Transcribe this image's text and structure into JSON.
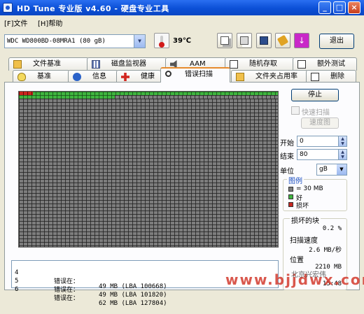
{
  "window": {
    "title": "HD Tune 专业版 v4.60 - 硬盘专业工具"
  },
  "titlebar_buttons": {
    "minimize": "_",
    "maximize": "□",
    "close": "×"
  },
  "menu": {
    "file": "[F]文件",
    "help": "[H]帮助"
  },
  "toolbar": {
    "drive": "WDC WD800BD-08MRA1 (80 gB)",
    "temperature": "39℃",
    "exit_label": "退出",
    "download_glyph": "↓"
  },
  "tabs_top": [
    {
      "label": "文件基准"
    },
    {
      "label": "磁盘监视器"
    },
    {
      "label": "AAM"
    },
    {
      "label": "随机存取"
    },
    {
      "label": "额外测试"
    }
  ],
  "tabs_bottom": [
    {
      "label": "基准"
    },
    {
      "label": "信息"
    },
    {
      "label": "健康"
    },
    {
      "label": "错误扫描"
    },
    {
      "label": "文件夹占用率"
    },
    {
      "label": "删除"
    }
  ],
  "controls": {
    "stop_label": "停止",
    "quick_scan_label": "快速扫描",
    "speed_map_label": "速度图",
    "start_label": "开始",
    "start_value": "0",
    "end_label": "结束",
    "end_value": "80",
    "unit_label": "单位",
    "unit_value": "gB"
  },
  "legend": {
    "title": "图例",
    "block_size": "= 30 MB",
    "good": "好",
    "bad": "损坏"
  },
  "stats": {
    "bad_blocks_label": "损坏的块",
    "bad_blocks_value": "0.2 %",
    "scan_speed_label": "扫描速度",
    "scan_speed_value": "2.6 MB/秒",
    "position_label": "位置",
    "position_value": "2210 MB",
    "time_value": "15:48"
  },
  "scan_progress": {
    "completed_rows_fraction": 0.06
  },
  "log": [
    {
      "index": "4",
      "text": "错误在：",
      "detail": "49 MB (LBA 100668)"
    },
    {
      "index": "5",
      "text": "错误在：",
      "detail": "49 MB (LBA 101820)"
    },
    {
      "index": "6",
      "text": "错误在：",
      "detail": "62 MB (LBA 127804)"
    }
  ],
  "watermark": {
    "main": "www.bjjdwx.com",
    "small": "北京兴宏伟"
  }
}
